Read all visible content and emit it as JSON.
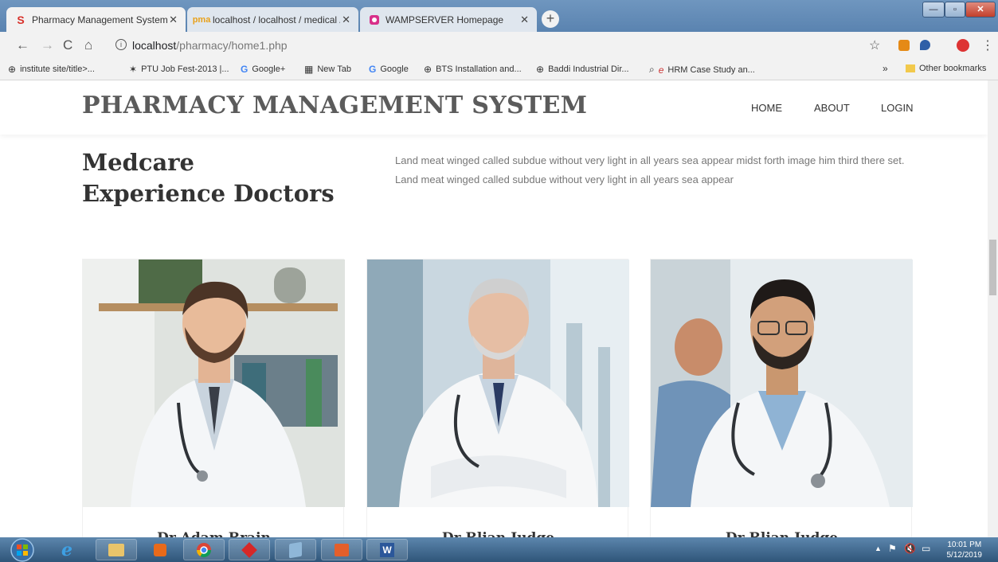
{
  "browser": {
    "tabs": [
      {
        "title": "Pharmacy Management System",
        "icon": "s-logo-icon"
      },
      {
        "title": "localhost / localhost / medical / t",
        "icon": "phpmyadmin-icon"
      },
      {
        "title": "WAMPSERVER Homepage",
        "icon": "wamp-icon"
      }
    ],
    "url_host": "localhost",
    "url_path": "/pharmacy/home1.php",
    "bookmarks": [
      {
        "label": "institute site/title>...",
        "icon": "globe-icon"
      },
      {
        "label": "PTU Job Fest-2013 |...",
        "icon": "star-icon"
      },
      {
        "label": "Google+",
        "icon": "google-icon"
      },
      {
        "label": "New Tab",
        "icon": "newtab-icon"
      },
      {
        "label": "Google",
        "icon": "google-icon"
      },
      {
        "label": "BTS Installation and...",
        "icon": "globe-icon"
      },
      {
        "label": "Baddi Industrial Dir...",
        "icon": "globe-icon"
      },
      {
        "label": "HRM Case Study an...",
        "icon": "search-icon"
      }
    ],
    "other_bookmarks": "Other bookmarks"
  },
  "page": {
    "site_title": "PHARMACY MANAGEMENT SYSTEM",
    "nav": [
      "HOME",
      "ABOUT",
      "LOGIN"
    ],
    "heading_line1": "Medcare",
    "heading_line2": "Experience Doctors",
    "intro": "Land meat winged called subdue without very light in all years sea appear midst forth image him third there set. Land meat winged called subdue without very light in all years sea appear",
    "doctors": [
      {
        "name": "Dr Adam Brain"
      },
      {
        "name": "Dr Blian Judge"
      },
      {
        "name": "Dr Blian Judge"
      }
    ]
  },
  "taskbar": {
    "time": "10:01 PM",
    "date": "5/12/2019"
  },
  "colors": {
    "accent_blue": "#2f5579",
    "heading": "#333333",
    "title_gray": "#5b5b5b"
  }
}
